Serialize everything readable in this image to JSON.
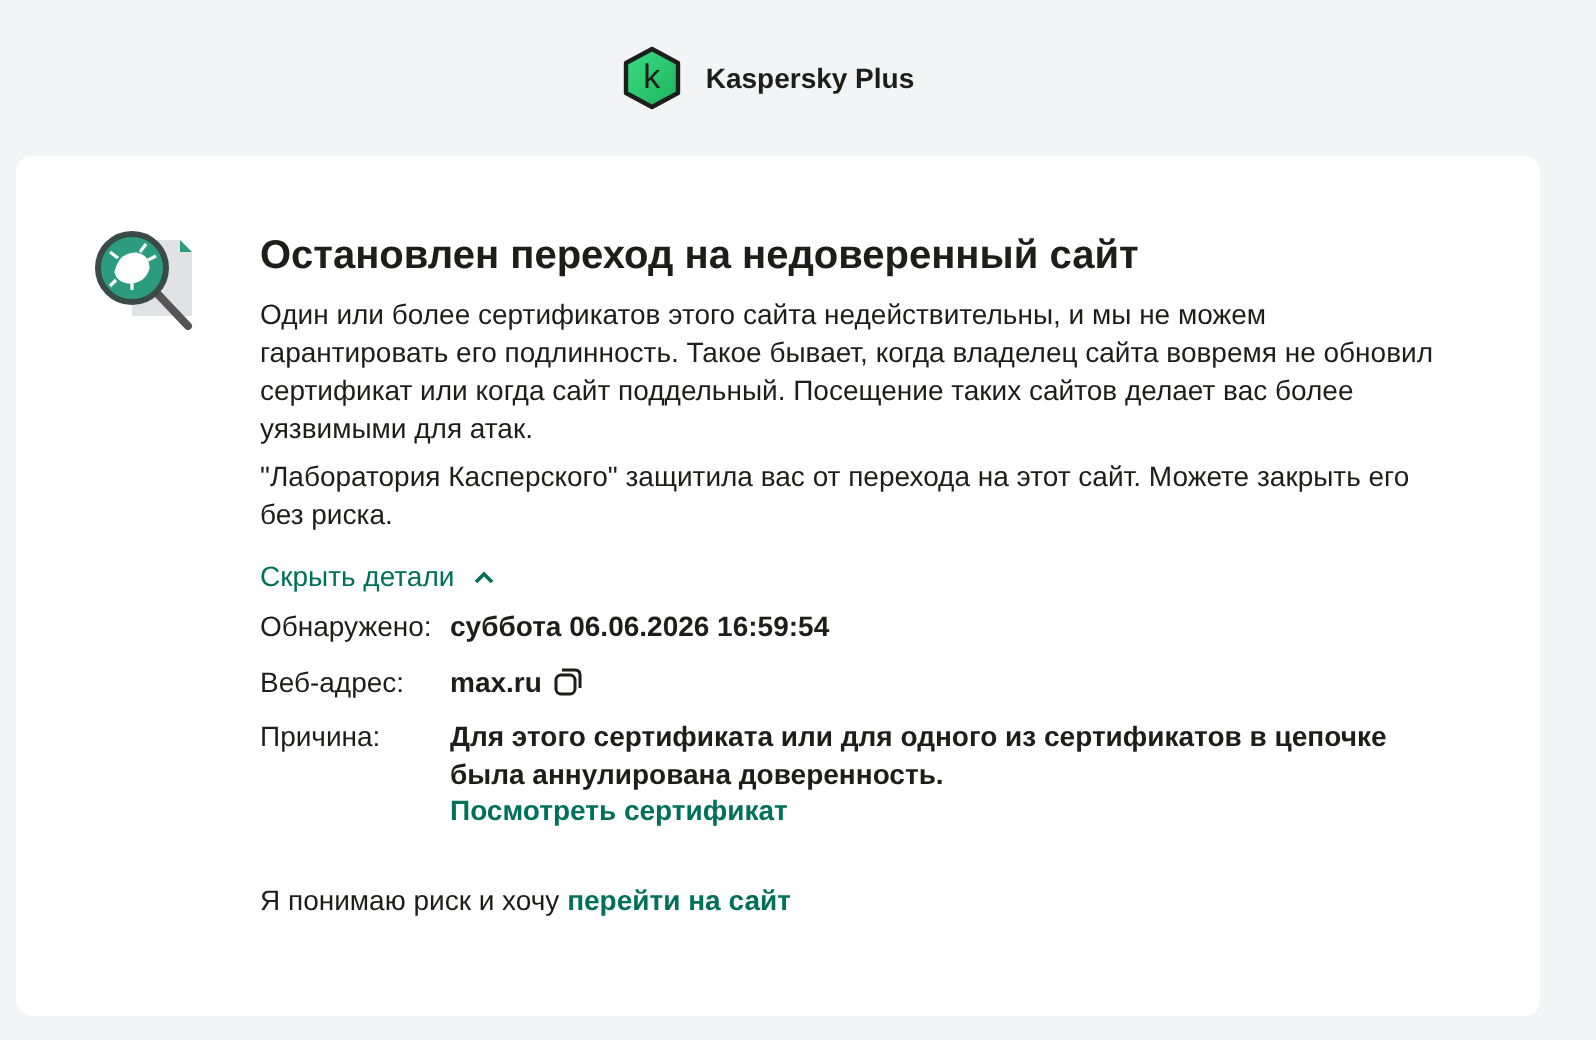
{
  "app": {
    "title": "Kaspersky Plus",
    "logo_letter": "k"
  },
  "alert": {
    "title": "Остановлен переход на недоверенный сайт",
    "paragraphs": [
      "Один или более сертификатов этого сайта недействительны, и мы не можем гарантировать его подлинность. Такое бывает, когда владелец сайта вовремя не обновил сертификат или когда сайт поддельный. Посещение таких сайтов делает вас более уязвимыми для атак.",
      "\"Лаборатория Касперского\" защитила вас от перехода на этот сайт. Можете закрыть его без риска."
    ],
    "details_toggle": {
      "label": "Скрыть детали",
      "expanded": true
    },
    "details": [
      {
        "label": "Обнаружено:",
        "value": "суббота 06.06.2026 16:59:54",
        "copyable": false
      },
      {
        "label": "Веб-адрес:",
        "value": "max.ru",
        "copyable": true
      },
      {
        "label": "Причина:",
        "value": "Для этого сертификата или для одного из сертификатов в цепочке была аннулирована доверенность.",
        "copyable": false,
        "link": "Посмотреть сертификат"
      }
    ],
    "proceed": {
      "text": "Я понимаю риск и хочу",
      "link": "перейти на сайт"
    }
  }
}
